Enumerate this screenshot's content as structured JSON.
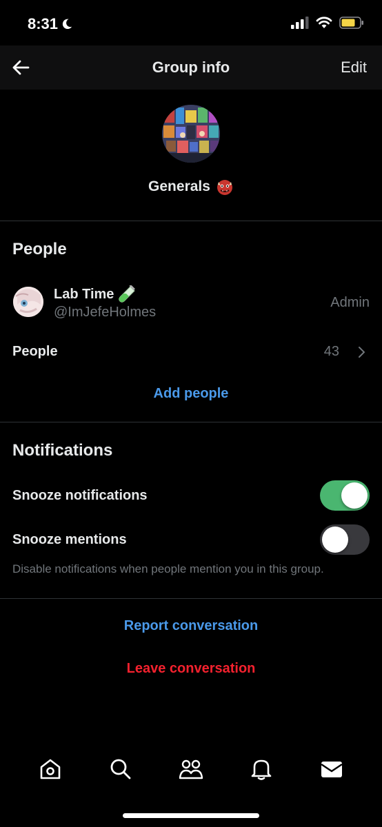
{
  "status_bar": {
    "time": "8:31",
    "icons": [
      "moon-icon",
      "cellular-signal-icon",
      "wifi-icon",
      "battery-icon"
    ],
    "battery_color": "#f5d547"
  },
  "nav": {
    "title": "Group info",
    "edit_label": "Edit",
    "back_icon": "arrow-left-icon"
  },
  "group": {
    "name": "Generals",
    "emoji_icon": "ogre-emoji-icon"
  },
  "people_section": {
    "title": "People",
    "member": {
      "name": "Lab Time",
      "badge_icon": "test-tube-icon",
      "handle": "@ImJefeHolmes",
      "role": "Admin"
    },
    "people_label": "People",
    "people_count": "43",
    "add_people_label": "Add people"
  },
  "notifications_section": {
    "title": "Notifications",
    "snooze_notifications_label": "Snooze notifications",
    "snooze_notifications_on": true,
    "snooze_mentions_label": "Snooze mentions",
    "snooze_mentions_on": false,
    "helper_text": "Disable notifications when people mention you in this group."
  },
  "actions": {
    "report_label": "Report conversation",
    "leave_label": "Leave conversation"
  },
  "tab_bar": {
    "items": [
      "home-icon",
      "search-icon",
      "communities-icon",
      "notifications-bell-icon",
      "messages-envelope-icon"
    ]
  },
  "colors": {
    "accent_blue": "#4a99e9",
    "danger_red": "#f4212e",
    "toggle_on": "#4ab670",
    "secondary_text": "#71767b"
  }
}
